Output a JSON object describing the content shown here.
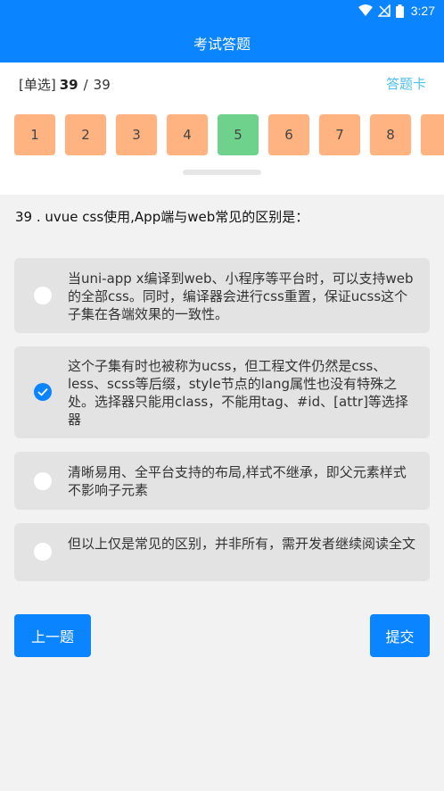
{
  "status": {
    "time": "3:27",
    "icons": [
      "wifi-icon",
      "no-signal-icon",
      "battery-icon"
    ]
  },
  "nav": {
    "title": "考试答题"
  },
  "info": {
    "type": "[单选]",
    "current": "39",
    "separator": "/",
    "total": "39",
    "card_link": "答题卡"
  },
  "numbers": [
    "1",
    "2",
    "3",
    "4",
    "5",
    "6",
    "7",
    "8",
    ""
  ],
  "active_number_index": 4,
  "question": {
    "text": "39 . uvue css使用,App端与web常见的区别是："
  },
  "options": [
    {
      "text": "当uni-app x编译到web、小程序等平台时，可以支持web的全部css。同时，编译器会进行css重置，保证ucss这个子集在各端效果的一致性。",
      "checked": false
    },
    {
      "text": "这个子集有时也被称为ucss，但工程文件仍然是css、less、scss等后缀，style节点的lang属性也没有特殊之处。选择器只能用class，不能用tag、#id、[attr]等选择器",
      "checked": true
    },
    {
      "text": "清晰易用、全平台支持的布局,样式不继承，即父元素样式不影响子元素",
      "checked": false
    },
    {
      "text": "但以上仅是常见的区别，并非所有，需开发者继续阅读全文",
      "checked": false
    }
  ],
  "buttons": {
    "prev": "上一题",
    "submit": "提交"
  },
  "colors": {
    "primary": "#0a84ff",
    "number_bg": "#ffb380",
    "number_active": "#6ed28c",
    "option_bg": "#e3e3e3",
    "link": "#4fc0f0"
  }
}
